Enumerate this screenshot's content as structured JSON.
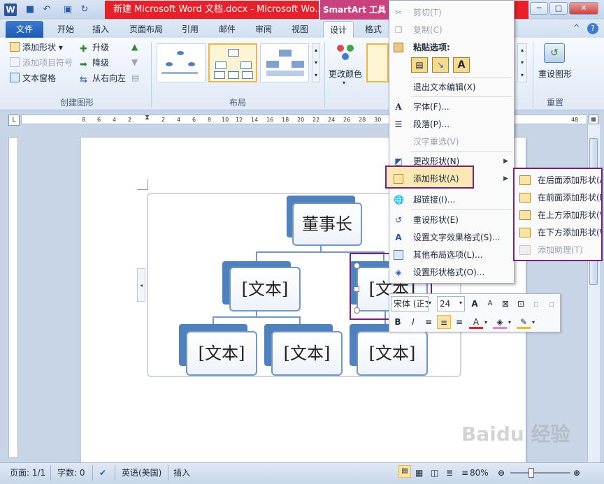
{
  "titlebar": {
    "title": "新建 Microsoft Word 文档.docx  -  Microsoft Wo...",
    "contextual_tab": "SmartArt 工具"
  },
  "tabs": [
    "文件",
    "开始",
    "插入",
    "页面布局",
    "引用",
    "邮件",
    "审阅",
    "视图",
    "设计",
    "格式"
  ],
  "ribbon": {
    "create_group": {
      "add_shape": "添加形状",
      "add_bullet": "添加项目符号",
      "text_pane": "文本窗格",
      "promote": "升级",
      "demote": "降级",
      "right_to_left": "从右向左",
      "label": "创建图形"
    },
    "layout_group_label": "布局",
    "change_colors": "更改颜色",
    "reset_graphic": "重设图形",
    "reset_group_label": "重置"
  },
  "ruler": {
    "ticks": [
      "8",
      "6",
      "4",
      "2",
      "2",
      "4",
      "6",
      "8",
      "10",
      "12",
      "14",
      "16",
      "18",
      "20",
      "22",
      "24",
      "26",
      "28",
      "30",
      "48"
    ],
    "corner": "L"
  },
  "smartart": {
    "top": "董事长",
    "mid_left": "[文本]",
    "mid_right": "[文本]",
    "bottom": [
      "[文本]",
      "[文本]",
      "[文本]"
    ]
  },
  "context_menu": {
    "cut": "剪切(T)",
    "copy": "复制(C)",
    "paste_options": "粘贴选项:",
    "exit_text_edit": "退出文本编辑(X)",
    "font": "字体(F)...",
    "paragraph": "段落(P)...",
    "hanzi_reselect": "汉字重选(V)",
    "change_shape": "更改形状(N)",
    "add_shape": "添加形状(A)",
    "hyperlink": "超链接(I)...",
    "reset_shape": "重设形状(E)",
    "text_effects": "设置文字效果格式(S)...",
    "more_layout": "其他布局选项(L)...",
    "format_shape": "设置形状格式(O)..."
  },
  "submenu": {
    "after": "在后面添加形状(A)",
    "before": "在前面添加形状(B)",
    "above": "在上方添加形状(V)",
    "below": "在下方添加形状(W)",
    "assistant": "添加助理(T)"
  },
  "minibar": {
    "font": "宋体 (正文",
    "size": "24"
  },
  "statusbar": {
    "page": "页面: 1/1",
    "words": "字数: 0",
    "language": "英语(美国)",
    "mode": "插入",
    "zoom": "80%"
  },
  "watermark": "Baidu 经验",
  "colors": {
    "accent_blue": "#4f81bd",
    "highlight_purple": "#7a1f7a",
    "title_red": "#e8202a",
    "smartart_tab": "#c9427e"
  }
}
